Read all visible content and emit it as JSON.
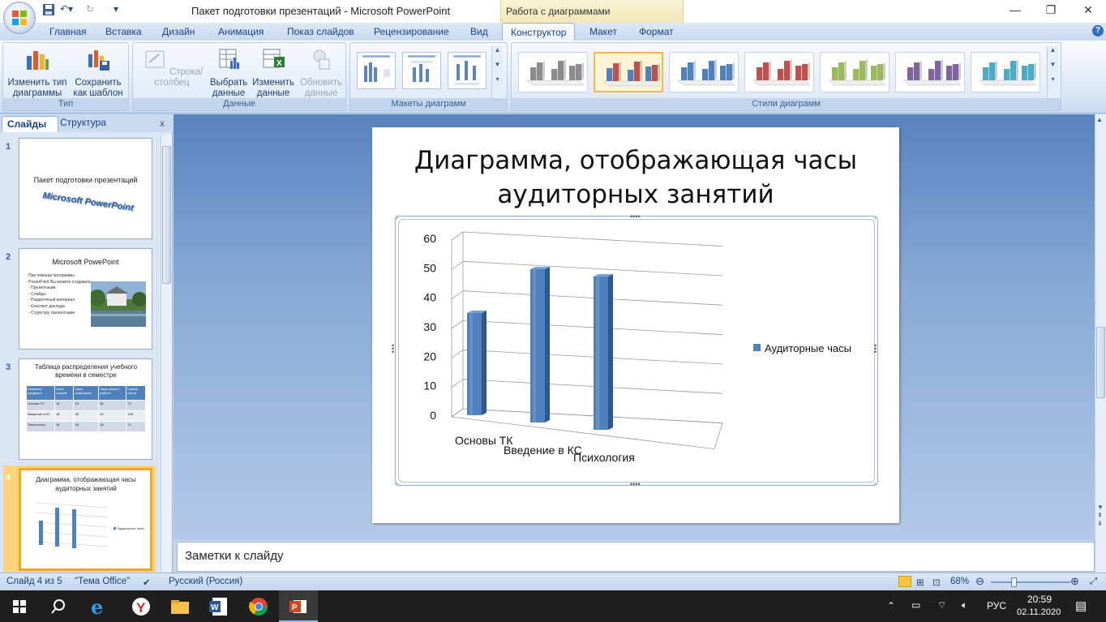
{
  "window": {
    "title": "Пакет подготовки презентаций - Microsoft PowerPoint",
    "chart_tools": "Работа с диаграммами",
    "controls": [
      "—",
      "❐",
      "✕"
    ]
  },
  "ribbon": {
    "tabs": [
      "Главная",
      "Вставка",
      "Дизайн",
      "Анимация",
      "Показ слайдов",
      "Рецензирование",
      "Вид",
      "Конструктор",
      "Макет",
      "Формат"
    ],
    "active_tab": "Конструктор",
    "groups": {
      "type": {
        "label": "Тип",
        "change_type": "Изменить тип диаграммы",
        "save_template": "Сохранить как шаблон"
      },
      "data": {
        "label": "Данные",
        "switch_row_col": "Строка/столбец",
        "select_data": "Выбрать данные",
        "edit_data": "Изменить данные",
        "refresh_data": "Обновить данные"
      },
      "layouts": {
        "label": "Макеты диаграмм"
      },
      "styles": {
        "label": "Стили диаграмм",
        "colors": [
          "#8c8c8c",
          "#4f81bd",
          "#4f81bd",
          "#c0504d",
          "#9bbb59",
          "#8064a2",
          "#4bacc6"
        ]
      }
    }
  },
  "left_pane": {
    "tab_slides": "Слайды",
    "tab_outline": "Структура",
    "close": "x",
    "slides": [
      {
        "num": "1",
        "title": "Пакет подготовки презентаций",
        "wordart": "Microsoft PowerPoint"
      },
      {
        "num": "2",
        "title": "Microsoft PowePoint",
        "bullets": [
          "При помощи программы PowerPoint Вы можете создавать:",
          "- Презентации",
          "- Слайды",
          "- Раздаточный материал",
          "- Конспект доклада",
          "- Структуру презентации"
        ]
      },
      {
        "num": "3",
        "title": "Таблица распределения учебного времени в семестре",
        "table": [
          [
            "Название предмета",
            "Часы лекций",
            "Часы семинаров",
            "Часы самост. работы",
            "Сумма часов"
          ],
          [
            "Основы ТК",
            "18",
            "18",
            "36",
            "72"
          ],
          [
            "Введение в КС",
            "18",
            "36",
            "54",
            "108"
          ],
          [
            "Психология",
            "18",
            "36",
            "18",
            "72"
          ]
        ]
      },
      {
        "num": "4",
        "title": "Диаграмма, отображающая часы аудиторных занятий"
      }
    ]
  },
  "slide": {
    "title": "Диаграмма, отображающая часы аудиторных занятий"
  },
  "chart_data": {
    "type": "bar",
    "title": "",
    "categories": [
      "Основы ТК",
      "Введение в КС",
      "Психология"
    ],
    "series": [
      {
        "name": "Аудиторные часы",
        "values": [
          36,
          54,
          54
        ]
      }
    ],
    "ylim": [
      0,
      60
    ],
    "yticks": [
      "0",
      "10",
      "20",
      "30",
      "40",
      "50",
      "60"
    ],
    "grid": true,
    "legend": "right",
    "color": "#4f81bd"
  },
  "notes": {
    "placeholder": "Заметки к слайду"
  },
  "status": {
    "slide_info": "Слайд 4 из 5",
    "theme": "\"Тема Office\"",
    "language": "Русский (Россия)",
    "zoom": "68%"
  },
  "taskbar": {
    "lang": "РУС",
    "time": "20:59",
    "date": "02.11.2020"
  }
}
